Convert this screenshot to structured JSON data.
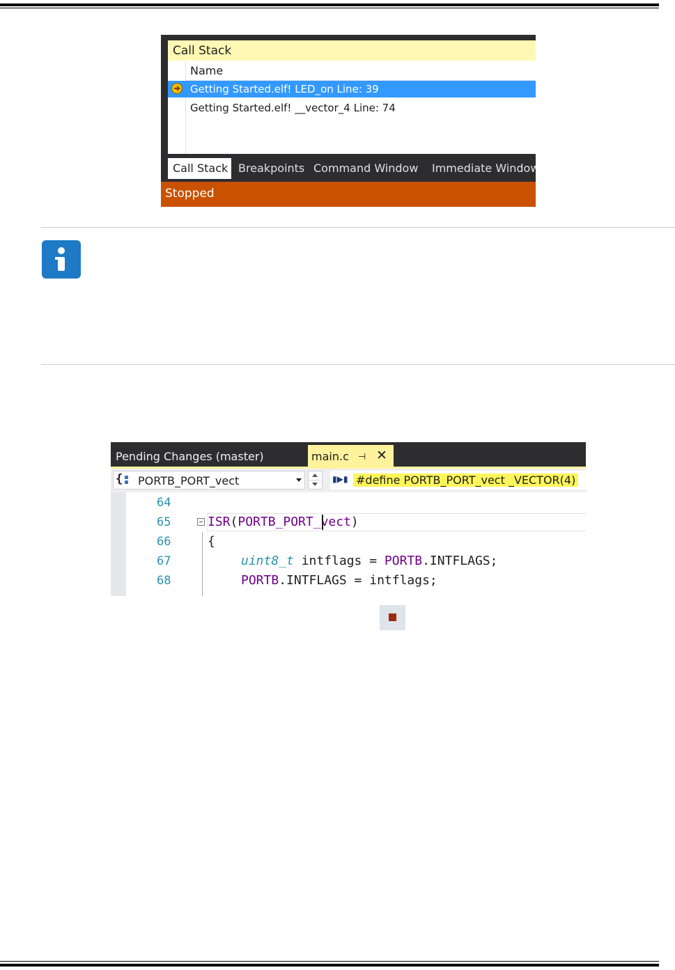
{
  "call_stack": {
    "title": "Call Stack",
    "column_header": "Name",
    "rows": [
      {
        "text": "Getting Started.elf! LED_on Line: 39",
        "selected": true,
        "icon": "current-frame-arrow-icon"
      },
      {
        "text": "Getting Started.elf! __vector_4 Line: 74",
        "selected": false
      }
    ],
    "tabs": [
      "Call Stack",
      "Breakpoints",
      "Command Window",
      "Immediate Window"
    ],
    "status": "Stopped",
    "colors": {
      "header": "#fff8b4",
      "selection": "#3399ff",
      "status_bar": "#ca5100"
    }
  },
  "info_note": {
    "icon": "info-icon",
    "color": "#1e7ac6"
  },
  "editor": {
    "tabs": {
      "pending": "Pending Changes (master)",
      "active": "main.c"
    },
    "navigation": {
      "symbol": "PORTB_PORT_vect",
      "definition": "#define PORTB_PORT_vect _VECTOR(4)"
    },
    "code_lines": [
      {
        "number": "64",
        "code": ""
      },
      {
        "number": "65",
        "code": "ISR(PORTB_PORT_vect)"
      },
      {
        "number": "66",
        "code": "{"
      },
      {
        "number": "67",
        "code": "    uint8_t intflags = PORTB.INTFLAGS;"
      },
      {
        "number": "68",
        "code": "    PORTB.INTFLAGS = intflags;"
      }
    ],
    "tokens": {
      "l65_fn": "ISR",
      "l65_open": "(",
      "l65_arg": "PORTB_PORT_vect",
      "l65_close": ")",
      "l67_type": "uint8_t",
      "l67_var": " intflags = ",
      "l67_port": "PORTB",
      "l67_rest": ".INTFLAGS;",
      "l68_port": "PORTB",
      "l68_rest": ".INTFLAGS = intflags;"
    },
    "highlight_color": "#fdf65a"
  },
  "toolbar": {
    "stop_icon": "stop-debugging-icon"
  }
}
